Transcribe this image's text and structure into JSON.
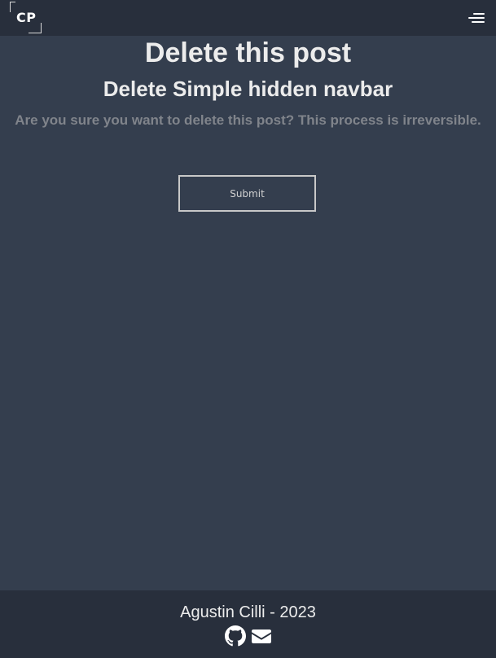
{
  "header": {
    "logo_text": "CP",
    "menu_icon": "hamburger-menu-icon"
  },
  "main": {
    "page_title": "Delete this post",
    "post_title": "Delete Simple hidden navbar",
    "warning": "Are you sure you want to delete this post? This process is irreversible.",
    "submit_label": "Submit"
  },
  "footer": {
    "text": "Agustin Cilli - 2023",
    "icons": [
      "github-icon",
      "envelope-icon"
    ]
  },
  "colors": {
    "background": "#343e4e",
    "bar": "#282f3c",
    "muted_text": "#80848b"
  }
}
